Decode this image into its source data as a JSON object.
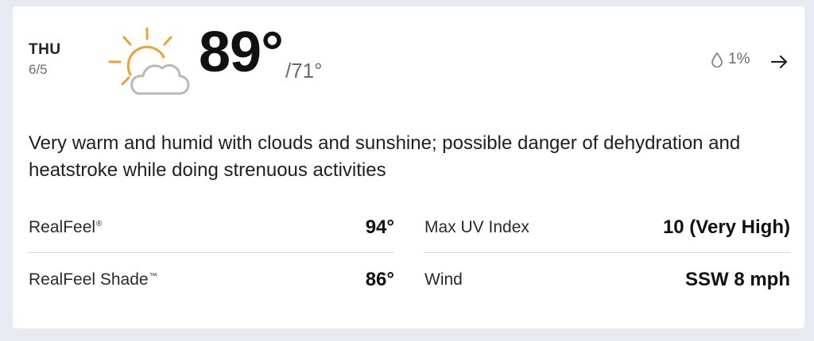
{
  "header": {
    "day_name": "THU",
    "day_date": "6/5",
    "icon": "partly-sunny-icon",
    "temp_high": "89°",
    "temp_low": "/71°",
    "precip_icon": "drop-icon",
    "precip": "1%",
    "arrow_icon": "arrow-right-icon"
  },
  "phrase": "Very warm and humid with clouds and sunshine; possible danger of dehydration and heatstroke while doing strenuous activities",
  "details": {
    "realfeel": {
      "label": "RealFeel",
      "mark": "®",
      "value": "94°"
    },
    "realfeel_shade": {
      "label": "RealFeel Shade",
      "mark": "™",
      "value": "86°"
    },
    "max_uv": {
      "label": "Max UV Index",
      "value": "10 (Very High)"
    },
    "wind": {
      "label": "Wind",
      "value": "SSW 8 mph"
    }
  },
  "colors": {
    "sun": "#f0a030",
    "cloud": "#b9b9b9",
    "background": "#e7ebf1",
    "card": "#ffffff"
  }
}
